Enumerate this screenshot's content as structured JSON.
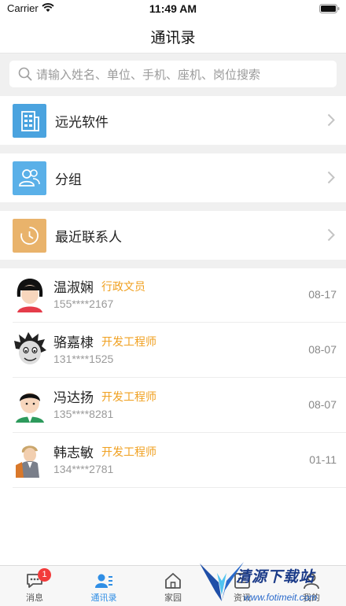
{
  "status_bar": {
    "carrier": "Carrier",
    "time": "11:49 AM"
  },
  "header": {
    "title": "通讯录"
  },
  "search": {
    "placeholder": "请输入姓名、单位、手机、座机、岗位搜索"
  },
  "entries": [
    {
      "label": "远光软件",
      "icon": "building-icon",
      "color": "#4aa3df"
    },
    {
      "label": "分组",
      "icon": "group-icon",
      "color": "#5ab0e8"
    },
    {
      "label": "最近联系人",
      "icon": "clock-icon",
      "color": "#e9b36b"
    }
  ],
  "contacts": [
    {
      "name": "温淑娴",
      "title": "行政文员",
      "phone": "155****2167",
      "date": "08-17"
    },
    {
      "name": "骆嘉棣",
      "title": "开发工程师",
      "phone": "131****1525",
      "date": "08-07"
    },
    {
      "name": "冯达扬",
      "title": "开发工程师",
      "phone": "135****8281",
      "date": "08-07"
    },
    {
      "name": "韩志敏",
      "title": "开发工程师",
      "phone": "134****2781",
      "date": "01-11"
    }
  ],
  "tabs": [
    {
      "label": "消息",
      "icon": "chat-icon",
      "badge": "1"
    },
    {
      "label": "通讯录",
      "icon": "contacts-icon",
      "active": true
    },
    {
      "label": "家园",
      "icon": "home-icon"
    },
    {
      "label": "资讯",
      "icon": "news-icon"
    },
    {
      "label": "我的",
      "icon": "profile-icon"
    }
  ],
  "watermark": {
    "text": "清源下载站",
    "url": "www.fotimeit.com"
  },
  "colors": {
    "accent": "#2f8ee5",
    "title_orange": "#f0a020",
    "badge_red": "#f23b3b"
  }
}
